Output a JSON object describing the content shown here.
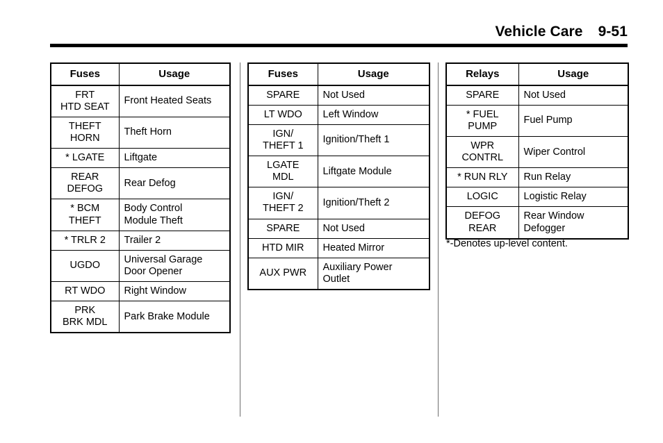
{
  "header": {
    "title": "Vehicle Care",
    "page_number": "9-51"
  },
  "tables": [
    {
      "id": "table-1",
      "columns": [
        "Fuses",
        "Usage"
      ],
      "rows": [
        {
          "code": "FRT\nHTD SEAT",
          "usage": "Front Heated Seats"
        },
        {
          "code": "THEFT\nHORN",
          "usage": "Theft Horn"
        },
        {
          "code": "* LGATE",
          "usage": "Liftgate"
        },
        {
          "code": "REAR\nDEFOG",
          "usage": "Rear Defog"
        },
        {
          "code": "* BCM\nTHEFT",
          "usage": "Body Control\nModule Theft"
        },
        {
          "code": "* TRLR 2",
          "usage": "Trailer 2"
        },
        {
          "code": "UGDO",
          "usage": "Universal Garage\nDoor Opener"
        },
        {
          "code": "RT WDO",
          "usage": "Right Window"
        },
        {
          "code": "PRK\nBRK MDL",
          "usage": "Park Brake Module"
        }
      ]
    },
    {
      "id": "table-2",
      "columns": [
        "Fuses",
        "Usage"
      ],
      "rows": [
        {
          "code": "SPARE",
          "usage": "Not Used"
        },
        {
          "code": "LT WDO",
          "usage": "Left Window"
        },
        {
          "code": "IGN/\nTHEFT 1",
          "usage": "Ignition/Theft 1"
        },
        {
          "code": "LGATE\nMDL",
          "usage": "Liftgate Module"
        },
        {
          "code": "IGN/\nTHEFT 2",
          "usage": "Ignition/Theft 2"
        },
        {
          "code": "SPARE",
          "usage": "Not Used"
        },
        {
          "code": "HTD MIR",
          "usage": "Heated Mirror"
        },
        {
          "code": "AUX PWR",
          "usage": "Auxiliary Power\nOutlet"
        }
      ]
    },
    {
      "id": "table-3",
      "columns": [
        "Relays",
        "Usage"
      ],
      "rows": [
        {
          "code": "SPARE",
          "usage": "Not Used"
        },
        {
          "code": "* FUEL\nPUMP",
          "usage": "Fuel Pump"
        },
        {
          "code": "WPR\nCONTRL",
          "usage": "Wiper Control"
        },
        {
          "code": "* RUN RLY",
          "usage": "Run Relay"
        },
        {
          "code": "LOGIC",
          "usage": "Logistic Relay"
        },
        {
          "code": "DEFOG\nREAR",
          "usage": "Rear Window\nDefogger"
        }
      ]
    }
  ],
  "footnote": "*-Denotes up-level content."
}
